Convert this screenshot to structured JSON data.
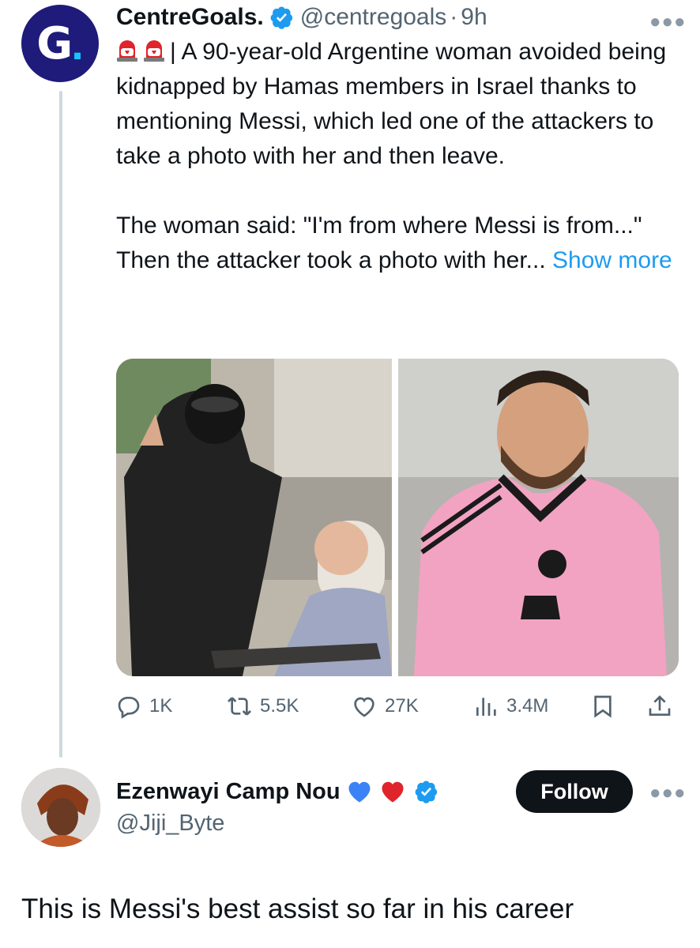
{
  "tweet": {
    "author_name": "CentreGoals.",
    "handle": "@centregoals",
    "separator": "·",
    "time": "9h",
    "avatar_letter": "G",
    "avatar_dot": ".",
    "line1_text": "| A 90-year-old Argentine woman avoided being kidnapped by Hamas members in Israel thanks to mentioning Messi, which led one of the attackers to take a photo with her and then leave.",
    "line2_text": "The woman said: \"I'm from where Messi is from...\" Then the attacker took a photo with her...",
    "show_more": "Show more",
    "emoji_icons": [
      "police-siren-icon",
      "police-siren-icon"
    ],
    "media": {
      "left_image_alt": "Armed man posing with elderly woman in wheelchair",
      "right_image_alt": "Smiling footballer in pink jersey"
    },
    "actions": {
      "replies": "1K",
      "reposts": "5.5K",
      "likes": "27K",
      "views": "3.4M"
    }
  },
  "reply": {
    "author_name": "Ezenwayi Camp Nou",
    "handle": "@Jiji_Byte",
    "follow_label": "Follow",
    "text": "This is Messi's best assist so far in his career"
  },
  "colors": {
    "verified": "#1d9bf0",
    "link": "#1d9bf0",
    "muted": "#536471",
    "follow_bg": "#0f1419",
    "avatar_bg": "#1f1b7a"
  }
}
